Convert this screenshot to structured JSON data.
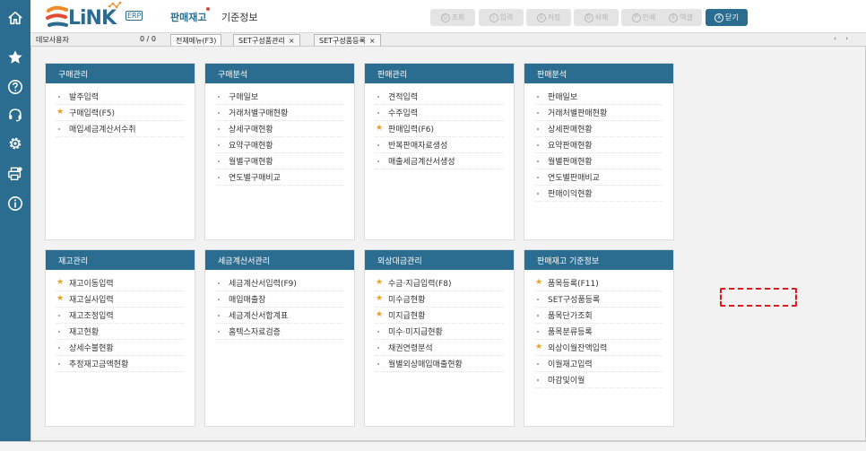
{
  "app": {
    "logo_text": "LiNK",
    "logo_badge": "ERP",
    "nav_main": "판매재고",
    "nav_sub": "기준정보"
  },
  "toolbar": {
    "buttons": [
      {
        "label": "조회",
        "icon": "Q"
      },
      {
        "label": "입력",
        "icon": "I"
      },
      {
        "label": "저장",
        "icon": "S"
      },
      {
        "label": "삭제",
        "icon": "D"
      },
      {
        "label": "인쇄",
        "icon": "P"
      },
      {
        "label": "엑셀",
        "icon": "E"
      },
      {
        "label": "닫기",
        "icon": "X"
      }
    ]
  },
  "tabbar": {
    "user": "데모사용자",
    "counter": "0 / 0",
    "tabs": [
      {
        "label": "전체메뉴(F3)"
      },
      {
        "label": "SET구성품관리",
        "close": "×"
      },
      {
        "label": "SET구성품등록",
        "close": "×"
      }
    ],
    "nav_arrows": "‹ ›"
  },
  "sidebar": {
    "icons": [
      "home-icon",
      "star-icon",
      "help-icon",
      "headset-icon",
      "gear-icon",
      "printer-icon",
      "info-icon"
    ]
  },
  "cards": [
    {
      "title": "구매관리",
      "items": [
        {
          "label": "발주입력",
          "star": false
        },
        {
          "label": "구매입력(F5)",
          "star": true
        },
        {
          "label": "매입세금계산서수취",
          "star": false
        }
      ]
    },
    {
      "title": "구매분석",
      "items": [
        {
          "label": "구매일보",
          "star": false
        },
        {
          "label": "거래처별구매현황",
          "star": false
        },
        {
          "label": "상세구매현황",
          "star": false
        },
        {
          "label": "요약구매현황",
          "star": false
        },
        {
          "label": "월별구매현황",
          "star": false
        },
        {
          "label": "연도별구매비교",
          "star": false
        }
      ]
    },
    {
      "title": "판매관리",
      "items": [
        {
          "label": "견적입력",
          "star": false
        },
        {
          "label": "수주입력",
          "star": false
        },
        {
          "label": "판매입력(F6)",
          "star": true
        },
        {
          "label": "반복판매자료생성",
          "star": false
        },
        {
          "label": "매출세금계산서생성",
          "star": false
        }
      ]
    },
    {
      "title": "판매분석",
      "items": [
        {
          "label": "판매일보",
          "star": false
        },
        {
          "label": "거래처별판매현황",
          "star": false
        },
        {
          "label": "상세판매현황",
          "star": false
        },
        {
          "label": "요약판매현황",
          "star": false
        },
        {
          "label": "월별판매현황",
          "star": false
        },
        {
          "label": "연도별판매비교",
          "star": false
        },
        {
          "label": "판매이익현황",
          "star": false
        }
      ]
    },
    {
      "title": "재고관리",
      "items": [
        {
          "label": "재고이동입력",
          "star": true
        },
        {
          "label": "재고실사입력",
          "star": true
        },
        {
          "label": "재고조정입력",
          "star": false
        },
        {
          "label": "재고현황",
          "star": false
        },
        {
          "label": "상세수불현황",
          "star": false
        },
        {
          "label": "추정재고금액현황",
          "star": false
        }
      ]
    },
    {
      "title": "세금계산서관리",
      "items": [
        {
          "label": "세금계산서입력(F9)",
          "star": false
        },
        {
          "label": "매입매출장",
          "star": false
        },
        {
          "label": "세금계산서합계표",
          "star": false
        },
        {
          "label": "홈텍스자료검증",
          "star": false
        }
      ]
    },
    {
      "title": "외상대금관리",
      "items": [
        {
          "label": "수금·지급입력(F8)",
          "star": true
        },
        {
          "label": "미수금현황",
          "star": true
        },
        {
          "label": "미지급현황",
          "star": true
        },
        {
          "label": "미수·미지급현황",
          "star": false
        },
        {
          "label": "채권연령분석",
          "star": false
        },
        {
          "label": "월별외상매입매출현황",
          "star": false
        }
      ]
    },
    {
      "title": "판매재고 기준정보",
      "items": [
        {
          "label": "품목등록(F11)",
          "star": true
        },
        {
          "label": "SET구성품등록",
          "star": false
        },
        {
          "label": "품목단가조회",
          "star": false
        },
        {
          "label": "품목분류등록",
          "star": false
        },
        {
          "label": "외상이월잔액입력",
          "star": true
        },
        {
          "label": "이월재고입력",
          "star": false
        },
        {
          "label": "마감및이월",
          "star": false
        }
      ]
    }
  ],
  "colors": {
    "brand": "#2b6d91",
    "star": "#f0a020",
    "highlight": "#e0191b",
    "logo_orange": "#f08a24",
    "logo_red": "#e24a32"
  }
}
